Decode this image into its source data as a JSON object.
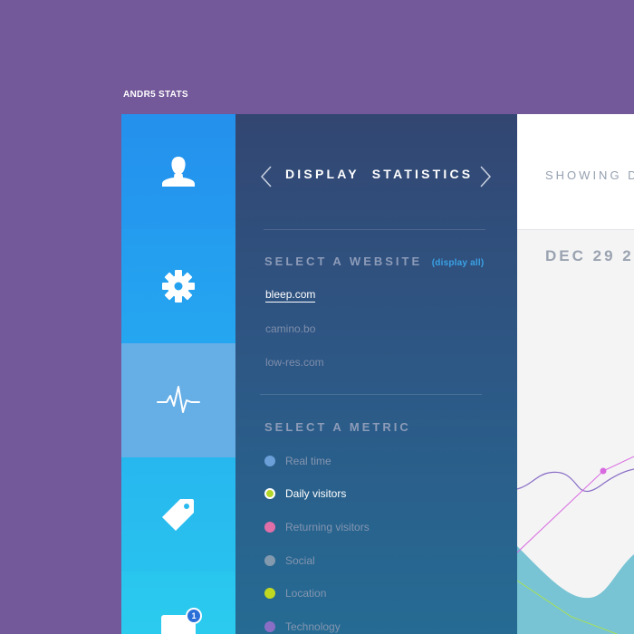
{
  "app": {
    "title": "ANDR5 STATS"
  },
  "rail": {
    "items": [
      {
        "name": "users",
        "icon": "user-icon"
      },
      {
        "name": "settings",
        "icon": "gear-icon"
      },
      {
        "name": "statistics",
        "icon": "pulse-icon",
        "active": true
      },
      {
        "name": "tags",
        "icon": "tag-icon"
      },
      {
        "name": "inbox",
        "icon": "inbox-icon",
        "badge": "1"
      }
    ]
  },
  "panel": {
    "title": "DISPLAY  STATISTICS",
    "website_section": {
      "title": "SELECT A WEBSITE",
      "display_all": "(display all)",
      "sites": [
        {
          "label": "bleep.com",
          "active": true
        },
        {
          "label": "camino.bo",
          "active": false
        },
        {
          "label": "low-res.com",
          "active": false
        }
      ]
    },
    "metric_section": {
      "title": "SELECT A METRIC",
      "metrics": [
        {
          "label": "Real time",
          "color": "#6a9fd8",
          "active": false
        },
        {
          "label": "Daily visitors",
          "color": "#b4d629",
          "active": true
        },
        {
          "label": "Returning visitors",
          "color": "#e06fa8",
          "active": false
        },
        {
          "label": "Social",
          "color": "#8399ad",
          "active": false
        },
        {
          "label": "Location",
          "color": "#c1d823",
          "active": false
        },
        {
          "label": "Technology",
          "color": "#8a6ec6",
          "active": false
        }
      ]
    }
  },
  "content": {
    "showing_label": "SHOWING D",
    "date_label": "DEC 29 2"
  },
  "colors": {
    "background": "#73589a",
    "accent_blue": "#2499ee",
    "area_fill": "#78c4d4",
    "line_pink": "#d86ae0",
    "line_purple": "#8a6ec6",
    "line_green": "#a8e056"
  }
}
